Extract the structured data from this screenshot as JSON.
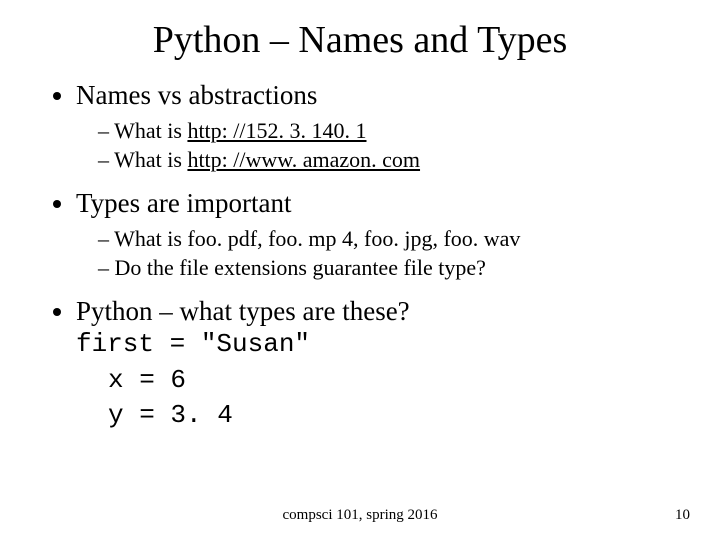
{
  "title": "Python – Names and Types",
  "bullets": {
    "b1": {
      "text": "Names vs abstractions",
      "sub": {
        "s1_prefix": "What is ",
        "s1_link": "http: //152. 3. 140. 1",
        "s2_prefix": "What is ",
        "s2_link": "http: //www. amazon. com"
      }
    },
    "b2": {
      "text": "Types are important",
      "sub": {
        "s1": "What is foo. pdf, foo. mp 4, foo. jpg, foo. wav",
        "s2": "Do the file extensions guarantee file type?"
      }
    },
    "b3": {
      "text": "Python – what types are these?",
      "code_inline": "first = \"Susan\"",
      "code_block": {
        "l1": "x = 6",
        "l2": "y = 3. 4"
      }
    }
  },
  "footer": {
    "center": "compsci 101, spring 2016",
    "page": "10"
  }
}
